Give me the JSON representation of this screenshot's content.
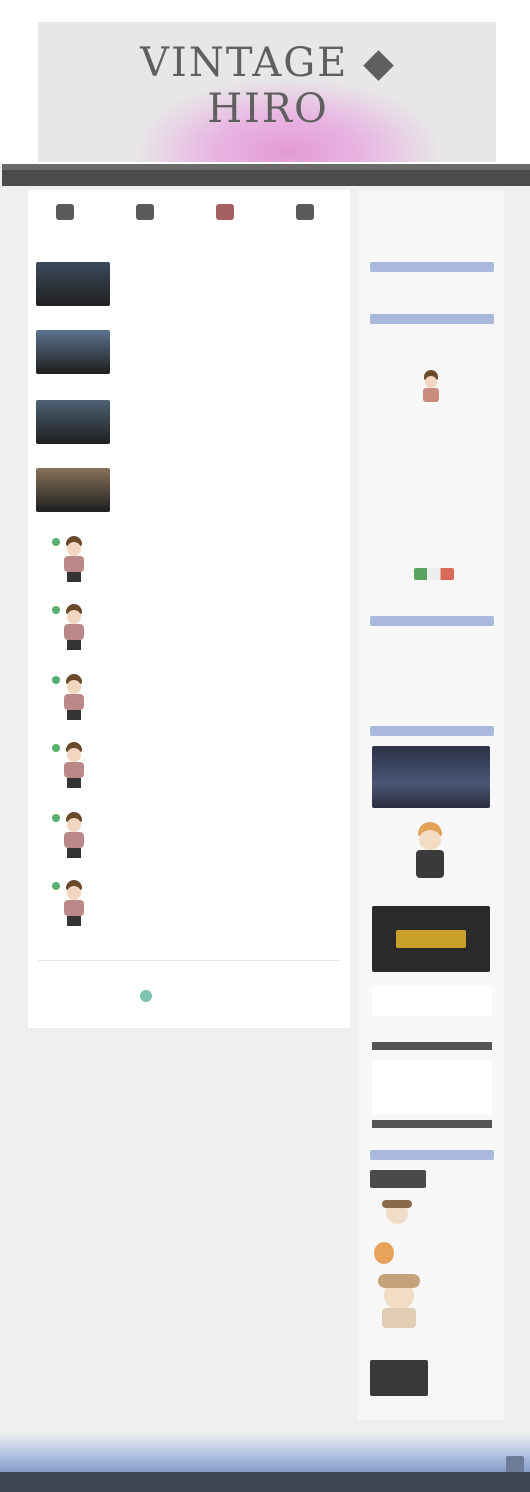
{
  "site": {
    "top_link": "",
    "logo_text": "VINTAGE ◆ HIRO",
    "tagline_1": "",
    "tagline_2": "",
    "accent": "#a9b9dc",
    "nav_color": "#4b4b4b"
  },
  "nav_icons": [
    {
      "label": ""
    },
    {
      "label": ""
    },
    {
      "label": ""
    },
    {
      "label": ""
    }
  ],
  "posts": [
    {
      "kind": "photo",
      "title": "",
      "excerpt": "",
      "meta": "",
      "color": "#3b4a5e"
    },
    {
      "kind": "photo",
      "title": "",
      "excerpt": "",
      "meta": "",
      "color": "#5b7390"
    },
    {
      "kind": "photo",
      "title": "",
      "excerpt": "",
      "meta": "",
      "color": "#4c6274"
    },
    {
      "kind": "photo",
      "title": "",
      "excerpt": "",
      "meta": "",
      "color": "#8a7259"
    },
    {
      "kind": "avatar",
      "title": "",
      "excerpt": "",
      "meta": ""
    },
    {
      "kind": "avatar",
      "title": "",
      "excerpt": "",
      "meta": ""
    },
    {
      "kind": "avatar",
      "title": "",
      "excerpt": "",
      "meta": ""
    },
    {
      "kind": "avatar",
      "title": "",
      "excerpt": "",
      "meta": ""
    },
    {
      "kind": "avatar",
      "title": "",
      "excerpt": "",
      "meta": ""
    },
    {
      "kind": "avatar",
      "title": "",
      "excerpt": "",
      "meta": ""
    }
  ],
  "pager": {
    "link": "",
    "text": ""
  },
  "sidebar": {
    "widgets": [
      {
        "heading": ""
      },
      {
        "heading": ""
      },
      {
        "heading": ""
      },
      {
        "heading": ""
      },
      {
        "heading": ""
      },
      {
        "heading": ""
      }
    ],
    "dark_heads": [
      {
        "heading": ""
      },
      {
        "heading": ""
      }
    ]
  },
  "footer": {
    "text": ""
  }
}
